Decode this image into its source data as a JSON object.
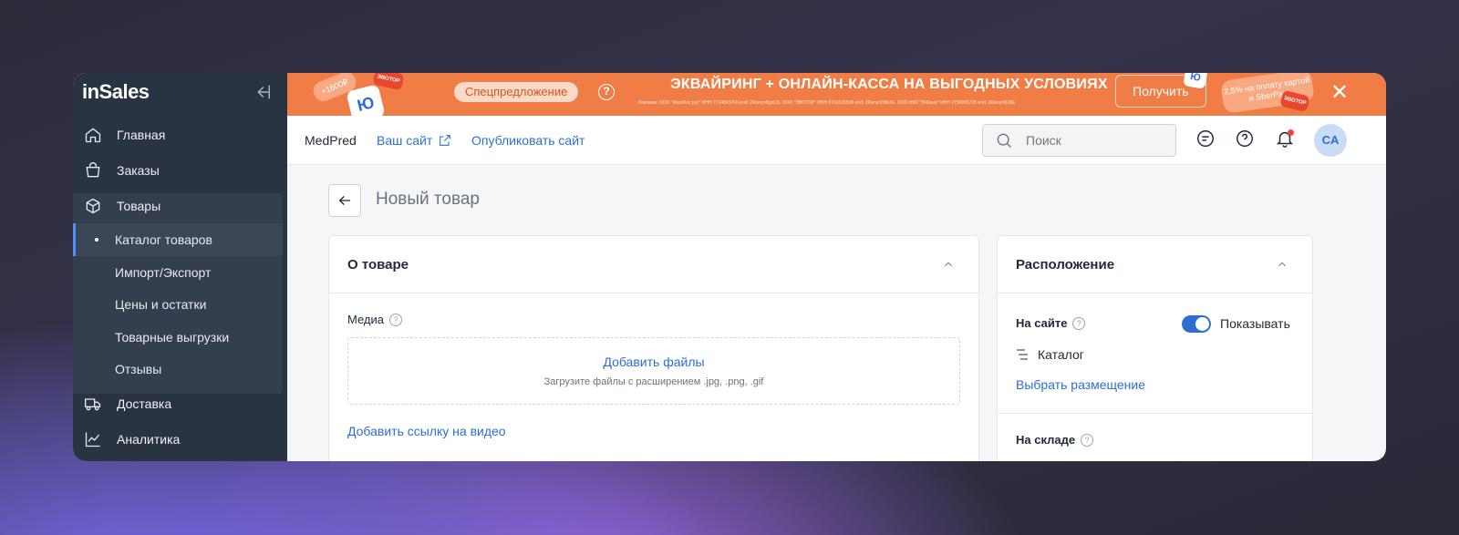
{
  "sidebar": {
    "logo": "inSales",
    "collapse_icon": "collapse-left-icon",
    "items": [
      {
        "label": "Главная",
        "icon": "home-icon"
      },
      {
        "label": "Заказы",
        "icon": "bag-icon"
      },
      {
        "label": "Товары",
        "icon": "box-icon"
      },
      {
        "label": "Доставка",
        "icon": "truck-icon"
      },
      {
        "label": "Аналитика",
        "icon": "chart-icon"
      }
    ],
    "products_sub": [
      {
        "label": "Каталог товаров",
        "active": true
      },
      {
        "label": "Импорт/Экспорт"
      },
      {
        "label": "Цены и остатки"
      },
      {
        "label": "Товарные выгрузки"
      },
      {
        "label": "Отзывы"
      }
    ]
  },
  "banner": {
    "promo_pill": "Спецпредложение",
    "title": "ЭКВАЙРИНГ + ОНЛАЙН-КАССА НА ВЫГОДНЫХ УСЛОВИЯХ",
    "legal": "Реклама: ООО \"Инсейлс рус\" ИНН 7714843760 erid: 2RanynBgnC8, ООО \"ЭВОТОР\" ИНН 9715225506 erid: 2RanynD8k3A, ООО НКО \"ЮМани\" ИНН 7750005725 erid: 2RanynN2fjE",
    "get_button": "Получить",
    "sber_tag": "2,5% на оплату картой и SberPay",
    "chip_bonus": "+1600₽",
    "chip_evotor": "ЭВОТОР",
    "chip_yu": "Ю",
    "color": "#f07d45"
  },
  "header": {
    "site_name": "MedPred",
    "site_link": "Ваш сайт",
    "publish_link": "Опубликовать сайт",
    "search_placeholder": "Поиск",
    "avatar_initials": "CA"
  },
  "page": {
    "title": "Новый товар"
  },
  "about_card": {
    "title": "О товаре",
    "media_label": "Медиа",
    "add_files": "Добавить файлы",
    "upload_hint": "Загрузите файлы с расширением .jpg, .png, .gif",
    "add_video_link": "Добавить ссылку на видео"
  },
  "location_card": {
    "title": "Расположение",
    "on_site_label": "На сайте",
    "show_toggle_label": "Показывать",
    "show_toggle_on": true,
    "catalog_label": "Каталог",
    "choose_placement": "Выбрать размещение",
    "in_stock_label": "На складе"
  }
}
